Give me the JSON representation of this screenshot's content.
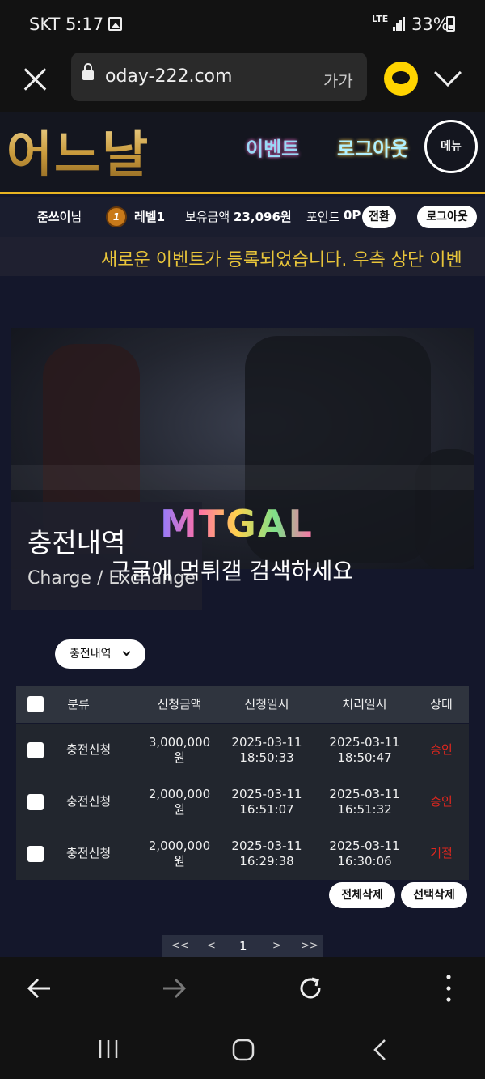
{
  "status_bar": {
    "carrier_time": "SKT 5:17",
    "network": "LTE",
    "battery": "33%"
  },
  "browser": {
    "url": "oday-222.com",
    "text_size_label": "가가"
  },
  "site": {
    "logo": "어느날",
    "nav_event": "이벤트",
    "nav_logout": "로그아웃",
    "menu_label": "메뉴"
  },
  "user": {
    "name": "준쓰이",
    "name_suffix": "님",
    "level_badge": "1",
    "level": "레벨1",
    "balance_label": "보유금액",
    "balance": "23,096원",
    "points_label": "포인트",
    "points": "0P",
    "convert_label": "전환",
    "logout_label": "로그아웃"
  },
  "notice": "새로운 이벤트가 등록되었습니다. 우측 상단 이벤",
  "banner": {
    "title": "충전내역",
    "subtitle": "Charge / Exchange",
    "watermark_logo": "MTGAL",
    "watermark_text": "구글에 먹튀갤 검색하세요"
  },
  "filter": {
    "selected": "충전내역"
  },
  "table": {
    "headers": [
      "분류",
      "신청금액",
      "신청일시",
      "처리일시",
      "상태"
    ],
    "rows": [
      {
        "type": "충전신청",
        "amount": "3,000,000",
        "unit": "원",
        "req_date": "2025-03-11",
        "req_time": "18:50:33",
        "proc_date": "2025-03-11",
        "proc_time": "18:50:47",
        "status": "승인"
      },
      {
        "type": "충전신청",
        "amount": "2,000,000",
        "unit": "원",
        "req_date": "2025-03-11",
        "req_time": "16:51:07",
        "proc_date": "2025-03-11",
        "proc_time": "16:51:32",
        "status": "승인"
      },
      {
        "type": "충전신청",
        "amount": "2,000,000",
        "unit": "원",
        "req_date": "2025-03-11",
        "req_time": "16:29:38",
        "proc_date": "2025-03-11",
        "proc_time": "16:30:06",
        "status": "거절"
      }
    ]
  },
  "actions": {
    "delete_all": "전체삭제",
    "delete_selected": "선택삭제"
  },
  "pagination": {
    "first": "<<",
    "prev": "<",
    "current": "1",
    "next": ">",
    "last": ">>"
  },
  "colors": {
    "accent_gold": "#e8b422",
    "notice_text": "#e8c53a",
    "status_red": "#e0261e",
    "background": "#14172b"
  },
  "icons": [
    "gallery-icon",
    "lock-icon",
    "kakao-icon",
    "back-arrow-icon",
    "forward-arrow-icon",
    "refresh-icon",
    "more-icon",
    "recent-apps-icon",
    "home-icon",
    "back-nav-icon"
  ]
}
